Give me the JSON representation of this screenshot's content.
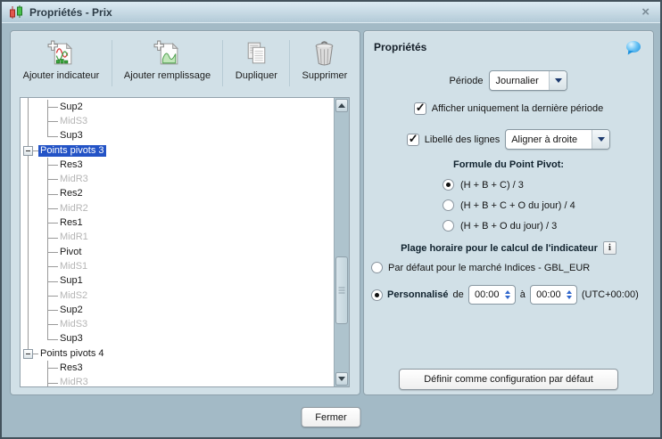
{
  "window": {
    "title": "Propriétés - Prix",
    "close_glyph": "×"
  },
  "toolbar": {
    "buttons": [
      {
        "label": "Ajouter indicateur",
        "icon": "add-indicator-icon"
      },
      {
        "label": "Ajouter remplissage",
        "icon": "add-fill-icon"
      },
      {
        "label": "Dupliquer",
        "icon": "duplicate-icon"
      },
      {
        "label": "Supprimer",
        "icon": "trash-icon"
      }
    ]
  },
  "tree": {
    "items": [
      {
        "label": "Sup2",
        "level": 2,
        "muted": false
      },
      {
        "label": "MidS3",
        "level": 2,
        "muted": true
      },
      {
        "label": "Sup3",
        "level": 2,
        "muted": false,
        "last": true
      },
      {
        "label": "Points pivots 3",
        "level": 1,
        "selected": true,
        "expanded": true
      },
      {
        "label": "Res3",
        "level": 2,
        "muted": false
      },
      {
        "label": "MidR3",
        "level": 2,
        "muted": true
      },
      {
        "label": "Res2",
        "level": 2,
        "muted": false
      },
      {
        "label": "MidR2",
        "level": 2,
        "muted": true
      },
      {
        "label": "Res1",
        "level": 2,
        "muted": false
      },
      {
        "label": "MidR1",
        "level": 2,
        "muted": true
      },
      {
        "label": "Pivot",
        "level": 2,
        "muted": false
      },
      {
        "label": "MidS1",
        "level": 2,
        "muted": true
      },
      {
        "label": "Sup1",
        "level": 2,
        "muted": false
      },
      {
        "label": "MidS2",
        "level": 2,
        "muted": true
      },
      {
        "label": "Sup2",
        "level": 2,
        "muted": false
      },
      {
        "label": "MidS3",
        "level": 2,
        "muted": true
      },
      {
        "label": "Sup3",
        "level": 2,
        "muted": false,
        "last": true
      },
      {
        "label": "Points pivots 4",
        "level": 1,
        "selected": false,
        "expanded": true
      },
      {
        "label": "Res3",
        "level": 2,
        "muted": false
      },
      {
        "label": "MidR3",
        "level": 2,
        "muted": true
      }
    ]
  },
  "properties": {
    "header": "Propriétés",
    "periode": {
      "label": "Période",
      "value": "Journalier"
    },
    "show_last_period": {
      "label": "Afficher uniquement la dernière période",
      "checked": true
    },
    "line_labels": {
      "label": "Libellé des lignes",
      "checked": true,
      "value": "Aligner à droite"
    },
    "formula": {
      "title": "Formule du Point Pivot:",
      "options": [
        {
          "label": "(H + B + C) / 3",
          "selected": true
        },
        {
          "label": "(H + B + C + O du jour) / 4",
          "selected": false
        },
        {
          "label": "(H + B + O du jour) / 3",
          "selected": false
        }
      ]
    },
    "time_range": {
      "title": "Plage horaire pour le calcul de l'indicateur",
      "info_glyph": "i",
      "options": [
        {
          "label": "Par défaut pour le marché Indices - GBL_EUR",
          "selected": false
        },
        {
          "label": "Personnalisé",
          "selected": true
        }
      ],
      "from_label": "de",
      "from_value": "00:00",
      "to_label": "à",
      "to_value": "00:00",
      "utc_label": "(UTC+00:00)"
    },
    "default_button": "Définir comme configuration par défaut"
  },
  "footer": {
    "close_button": "Fermer"
  },
  "colors": {
    "selection": "#2353c6",
    "accent_blue": "#2f66cc",
    "panel": "#d1e0e7",
    "window_bg": "#a3bac6"
  }
}
